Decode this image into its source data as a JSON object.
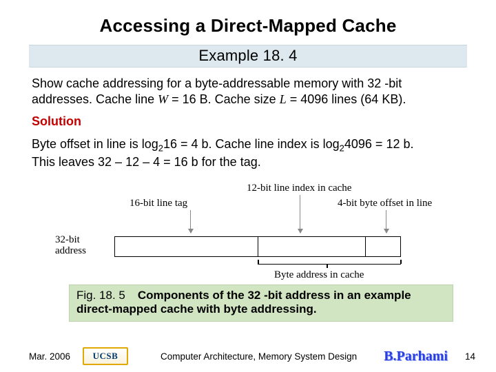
{
  "title": "Accessing a Direct-Mapped Cache",
  "example_label": "Example 18. 4",
  "problem_line1": "Show cache addressing for a byte-addressable memory with 32 -bit",
  "problem_line2_a": "addresses. Cache line ",
  "problem_var_W": "W",
  "problem_line2_b": " = 16 B. Cache size ",
  "problem_var_L": "L",
  "problem_line2_c": " = 4096 lines (64 KB).",
  "solution_label": "Solution",
  "sol_line1_a": "Byte offset in line is log",
  "sol_line1_b": "16 = 4 b. Cache line index is log",
  "sol_line1_c": "4096 = 12 b.",
  "sol_line2": "This leaves 32 – 12 – 4 = 16 b for the tag.",
  "log_sub": "2",
  "diagram": {
    "addr_label_1": "32-bit",
    "addr_label_2": "address",
    "tag_label": "16-bit line tag",
    "index_label": "12-bit line index in cache",
    "offset_label": "4-bit byte offset in line",
    "brace_label": "Byte address in cache"
  },
  "caption_fig": "Fig. 18. 5",
  "caption_text": "Components of the 32 -bit address in an example direct-mapped cache with byte addressing.",
  "footer": {
    "date": "Mar. 2006",
    "logo": "UCSB",
    "center": "Computer Architecture, Memory System Design",
    "author": "B.Parhami",
    "page": "14"
  }
}
